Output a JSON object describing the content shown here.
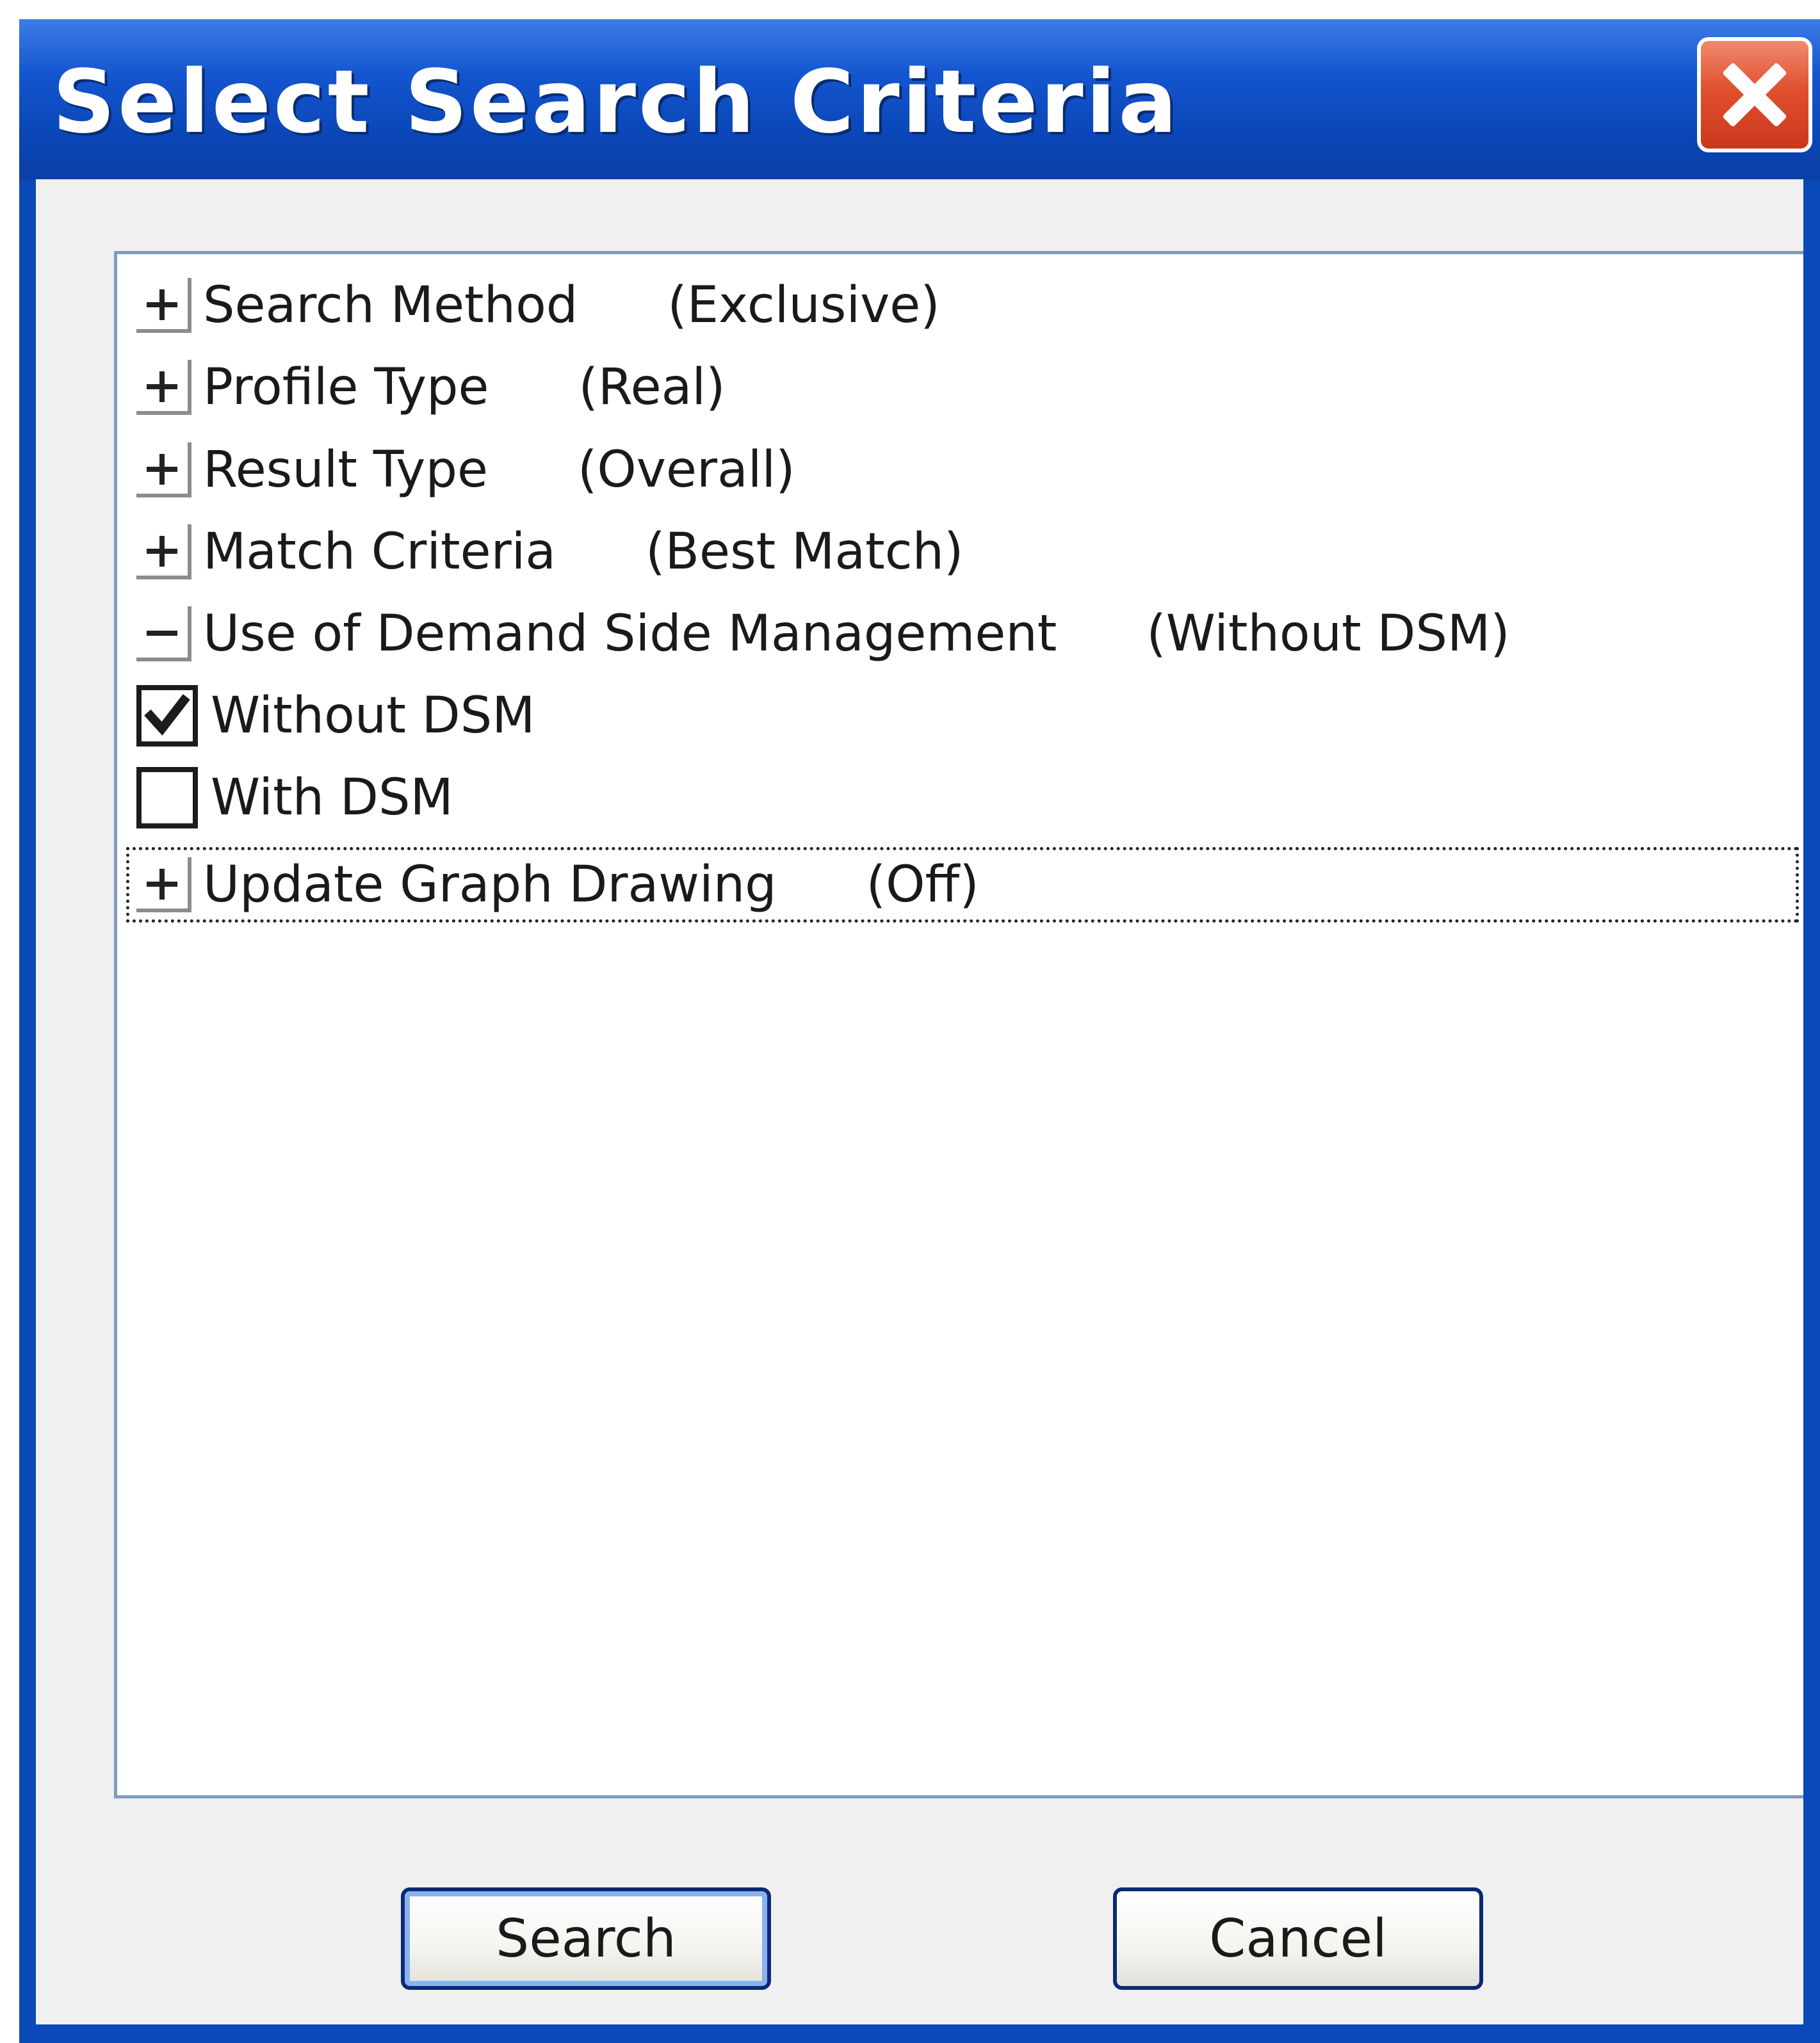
{
  "window": {
    "title": "Select Search Criteria"
  },
  "tree": {
    "items": [
      {
        "label": "Search Method",
        "value": "(Exclusive)",
        "expander": "+"
      },
      {
        "label": "Profile Type",
        "value": "(Real)",
        "expander": "+"
      },
      {
        "label": "Result Type",
        "value": "(Overall)",
        "expander": "+"
      },
      {
        "label": "Match Criteria",
        "value": "(Best Match)",
        "expander": "+"
      },
      {
        "label": "Use of Demand Side Management",
        "value": "(Without DSM)",
        "expander": "−",
        "options": [
          {
            "label": "Without DSM",
            "checked": true
          },
          {
            "label": "With DSM",
            "checked": false
          }
        ]
      },
      {
        "label": "Update Graph Drawing",
        "value": "(Off)",
        "expander": "+"
      }
    ]
  },
  "buttons": {
    "search": "Search",
    "cancel": "Cancel"
  },
  "colors": {
    "titlebar": "#0a49b8",
    "close": "#e0502f",
    "client": "#f0f0f0",
    "tree_border": "#7f9db9",
    "button_border": "#0b2a72"
  }
}
